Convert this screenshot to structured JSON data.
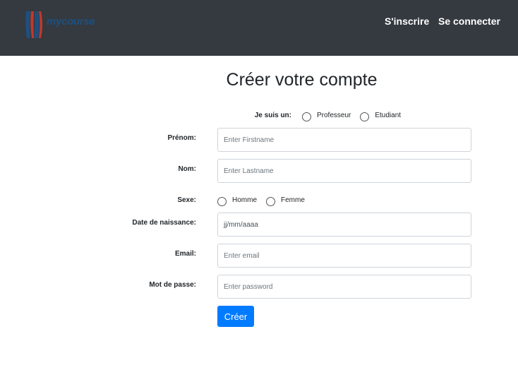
{
  "navbar": {
    "brand": "mycourse",
    "links": [
      "S'inscrire",
      "Se connecter"
    ]
  },
  "page_title": "Créer votre compte",
  "form": {
    "role_label": "Je suis un:",
    "roles": [
      "Professeur",
      "Etudiant"
    ],
    "firstname_label": "Prénom:",
    "firstname_placeholder": "Enter Firstname",
    "lastname_label": "Nom:",
    "lastname_placeholder": "Enter Lastname",
    "gender_label": "Sexe:",
    "genders": [
      "Homme",
      "Femme"
    ],
    "birthdate_label": "Date de naissance:",
    "birthdate_placeholder": "jj/mm/aaaa",
    "email_label": "Email:",
    "email_placeholder": "Enter email",
    "password_label": "Mot de passe:",
    "password_placeholder": "Enter password",
    "submit_label": "Créer"
  },
  "colors": {
    "navbar": "#343a40",
    "primary": "#007bff",
    "logo_blue": "#1f4f7e",
    "logo_red": "#c0392b"
  }
}
